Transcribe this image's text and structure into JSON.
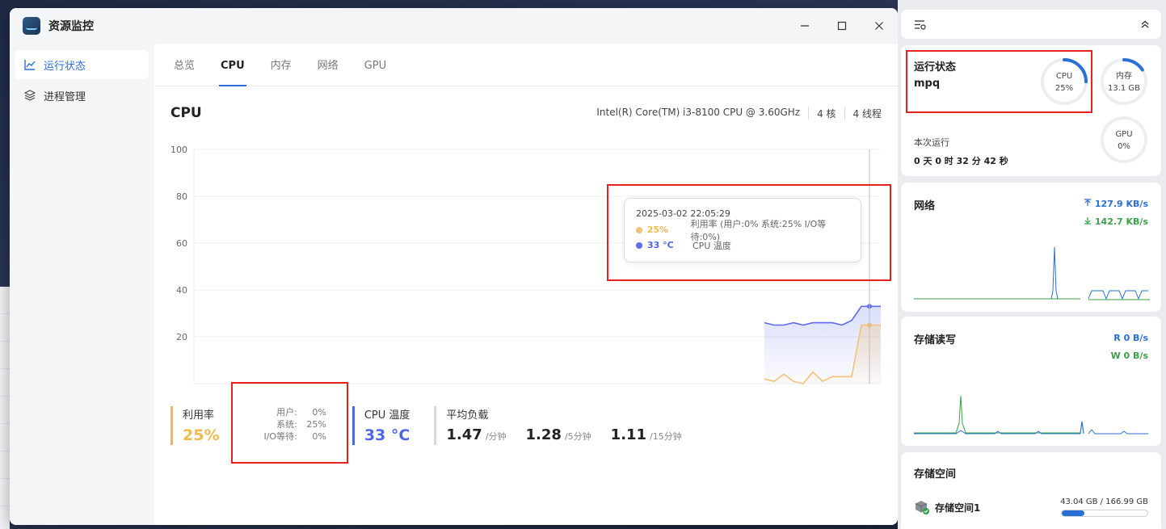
{
  "app": {
    "title": "资源监控"
  },
  "sidebar": {
    "items": [
      {
        "label": "运行状态"
      },
      {
        "label": "进程管理"
      }
    ]
  },
  "tabs": [
    {
      "label": "总览"
    },
    {
      "label": "CPU"
    },
    {
      "label": "内存"
    },
    {
      "label": "网络"
    },
    {
      "label": "GPU"
    }
  ],
  "cpu": {
    "title": "CPU",
    "model": "Intel(R) Core(TM) i3-8100 CPU @ 3.60GHz",
    "cores": "4 核",
    "threads": "4 线程"
  },
  "tooltip": {
    "timestamp": "2025-03-02 22:05:29",
    "util_value": "25%",
    "util_label": "利用率 (用户:0% 系统:25% I/O等待:0%)",
    "temp_value": "33 °C",
    "temp_label": "CPU 温度"
  },
  "stats": {
    "util_label": "利用率",
    "util_value": "25%",
    "user_label": "用户:",
    "user_value": "0%",
    "sys_label": "系统:",
    "sys_value": "25%",
    "io_label": "I/O等待:",
    "io_value": "0%",
    "temp_label": "CPU 温度",
    "temp_value": "33 °C",
    "load_label": "平均负载",
    "load_1": "1.47",
    "load_1_unit": "/分钟",
    "load_5": "1.28",
    "load_5_unit": "/5分钟",
    "load_15": "1.11",
    "load_15_unit": "/15分钟"
  },
  "chart_data": {
    "type": "line",
    "ylim": [
      0,
      100
    ],
    "yticks": [
      "100",
      "80",
      "60",
      "40",
      "20"
    ],
    "series": [
      {
        "values": [
          26,
          25,
          25,
          26,
          25,
          26,
          26,
          26,
          25,
          27,
          33,
          33,
          33
        ]
      },
      {
        "values": [
          2,
          1,
          4,
          1,
          0,
          5,
          1,
          3,
          3,
          3,
          25,
          25,
          25
        ]
      }
    ],
    "colors": {
      "temp": "#5b6cf0",
      "util": "#f2c27a"
    }
  },
  "panel": {
    "status": {
      "title": "运行状态",
      "host": "mpq",
      "cpu_label": "CPU",
      "cpu_value": "25%",
      "cpu_pct": 25,
      "mem_label": "内存",
      "mem_value": "13.1 GB",
      "mem_pct": 16,
      "gpu_label": "GPU",
      "gpu_value": "0%",
      "gpu_pct": 0,
      "uptime_label": "本次运行",
      "uptime_value": "0 天 0 时 32 分 42 秒"
    },
    "network": {
      "title": "网络",
      "up": "127.9 KB/s",
      "down": "142.7 KB/s"
    },
    "disk_io": {
      "title": "存储读写",
      "read": "R  0 B/s",
      "write": "W  0 B/s"
    },
    "storage": {
      "title": "存储空间",
      "name": "存储空间1",
      "usage": "43.04 GB / 166.99 GB",
      "fill": 0.26
    }
  }
}
